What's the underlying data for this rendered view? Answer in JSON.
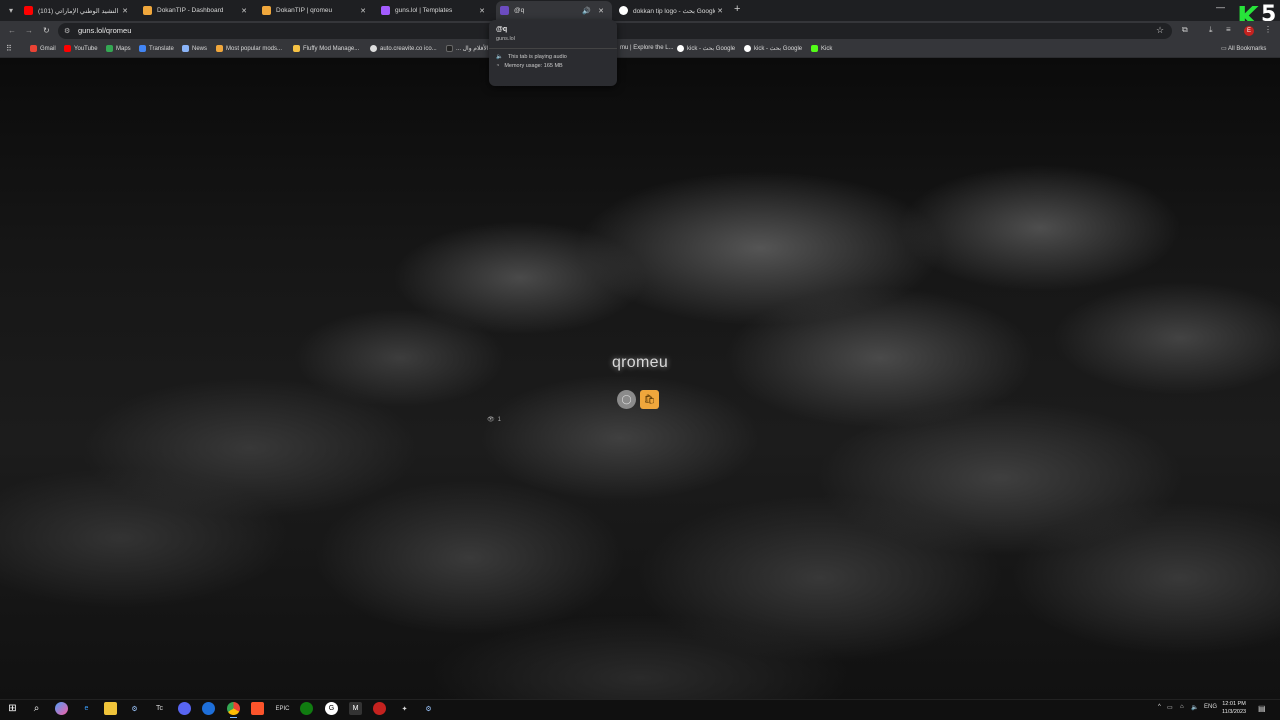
{
  "tabs": [
    {
      "title": "(101) النشيد الوطني الإماراتي - ...",
      "favicon_color": "#ff0000",
      "active": false
    },
    {
      "title": "DokanTIP - Dashboard",
      "favicon_color": "#f0a73c",
      "active": false
    },
    {
      "title": "DokanTIP | qromeu",
      "favicon_color": "#f0a73c",
      "active": false
    },
    {
      "title": "guns.lol | Templates",
      "favicon_color": "#a35cff",
      "active": false
    },
    {
      "title": "@q",
      "favicon_color": "#6c4cc0",
      "active": true,
      "audio": true
    },
    {
      "title": "dokkan tip logo - بحث Google",
      "favicon_color": "#ffffff",
      "active": false
    }
  ],
  "tab_close_glyph": "✕",
  "new_tab_glyph": "+",
  "tooltip": {
    "title": "@q",
    "url": "guns.lol",
    "audio_text": "This tab is playing audio",
    "memory_text": "Memory usage: 165 MB"
  },
  "omnibox": {
    "url": "guns.lol/qromeu"
  },
  "bookmarks": [
    {
      "label": "Gmail",
      "color": "#ea4335"
    },
    {
      "label": "YouTube",
      "color": "#ff0000"
    },
    {
      "label": "Maps",
      "color": "#34a853"
    },
    {
      "label": "Translate",
      "color": "#4285f4"
    },
    {
      "label": "News",
      "color": "#8ab4f8"
    },
    {
      "label": "Most popular mods...",
      "color": "#f0a73c"
    },
    {
      "label": "Fluffy Mod Manage...",
      "color": "#f6c244"
    },
    {
      "label": "auto.creavite.co ico...",
      "color": "#dddddd"
    },
    {
      "label": "... الأفلام وال",
      "color": "#222222"
    },
    {
      "label": "mu | Explore the L...",
      "color": "#ffffff"
    },
    {
      "label": "kick - بحث Google",
      "color": "#ffffff"
    },
    {
      "label": "kick - بحث Google",
      "color": "#ffffff"
    },
    {
      "label": "Kick",
      "color": "#53fc18"
    }
  ],
  "all_bookmarks_label": "All Bookmarks",
  "profile": {
    "name": "qromeu",
    "views": "1"
  },
  "avatar_letter": "E",
  "logo": {
    "k": "K",
    "five": "5"
  },
  "taskbar": {
    "lang": "ENG",
    "time": "12:01 PM",
    "date": "11/3/2023"
  }
}
